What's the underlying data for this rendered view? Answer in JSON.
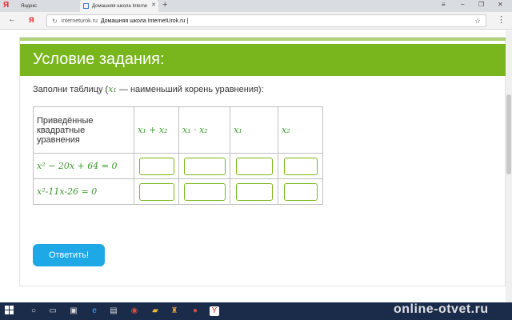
{
  "browser": {
    "tabs": [
      {
        "label": "Яндекс"
      },
      {
        "label": "Домашняя школа Interne"
      }
    ],
    "address": {
      "host": "internetu­rok.ru",
      "title": "Домашняя школа InternetUrok.ru |"
    }
  },
  "page": {
    "header_title": "Условие задания:",
    "instruction_prefix": "Заполни таблицу (",
    "instruction_var": "x₁",
    "instruction_suffix": " — наименьший корень уравнения):",
    "table": {
      "first_header": "Приведённые квадратные уравнения",
      "headers": [
        "x₁ + x₂",
        "x₁ · x₂",
        "x₁",
        "x₂"
      ],
      "rows": [
        {
          "equation": "x² − 20x + 64 = 0"
        },
        {
          "equation": "x²-11x-26 = 0"
        }
      ]
    },
    "submit_label": "Ответить!"
  },
  "taskbar": {
    "watermark": "online-otvet.ru"
  },
  "colors": {
    "header": "#79b51c",
    "button": "#1ea8e6",
    "input_border": "#7ab81a"
  }
}
